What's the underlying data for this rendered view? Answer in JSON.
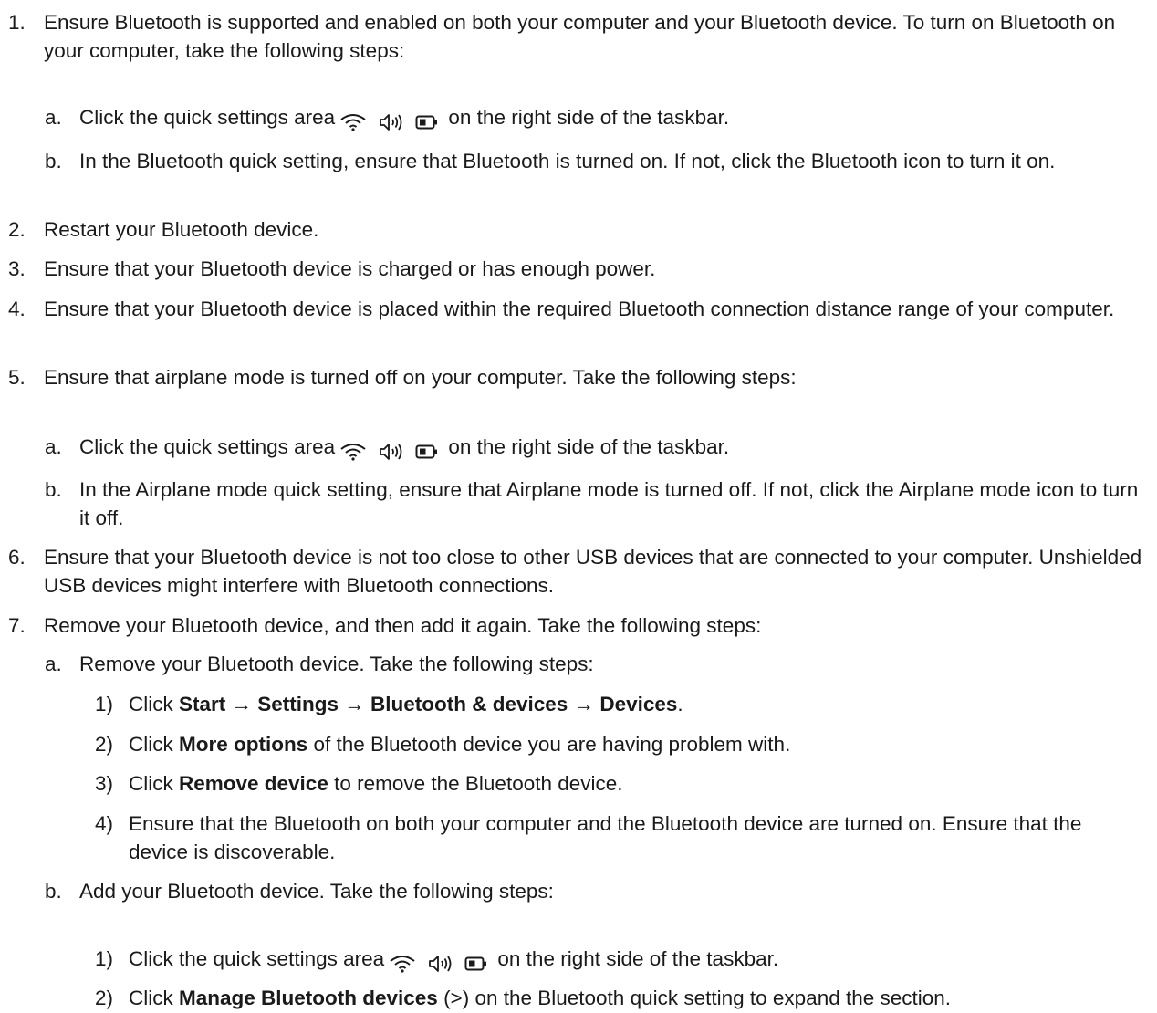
{
  "steps": [
    {
      "num": "1.",
      "text": "Ensure Bluetooth is supported and enabled on both your computer and your Bluetooth device. To turn on Bluetooth on your computer, take the following steps:"
    },
    {
      "num": "a.",
      "pre": "Click the quick settings area",
      "post": "on the right side of the taskbar."
    },
    {
      "num": "b.",
      "text": "In the Bluetooth quick setting, ensure that Bluetooth is turned on. If not, click the Bluetooth icon to turn it on."
    },
    {
      "num": "2.",
      "text": "Restart your Bluetooth device."
    },
    {
      "num": "3.",
      "text": "Ensure that your Bluetooth device is charged or has enough power."
    },
    {
      "num": "4.",
      "text": "Ensure that your Bluetooth device is placed within the required Bluetooth connection distance range of your computer."
    },
    {
      "num": "5.",
      "text": "Ensure that airplane mode is turned off on your computer. Take the following steps:"
    },
    {
      "num": "a.",
      "pre": "Click the quick settings area",
      "post": "on the right side of the taskbar."
    },
    {
      "num": "b.",
      "text": "In the Airplane mode quick setting, ensure that Airplane mode is turned off. If not, click the Airplane mode icon to turn it off."
    },
    {
      "num": "6.",
      "text": "Ensure that your Bluetooth device is not too close to other USB devices that are connected to your computer. Unshielded USB devices might interfere with Bluetooth connections."
    },
    {
      "num": "7.",
      "text": "Remove your Bluetooth device, and then add it again. Take the following steps:"
    },
    {
      "num": "a.",
      "text": "Remove your Bluetooth device. Take the following steps:"
    },
    {
      "num": "1)",
      "pre": "Click ",
      "bold": "Start → Settings → Bluetooth & devices → Devices",
      "post": "."
    },
    {
      "num": "2)",
      "pre": "Click ",
      "bold": "More options",
      "post": " of the Bluetooth device you are having problem with."
    },
    {
      "num": "3)",
      "pre": "Click ",
      "bold": "Remove device",
      "post": " to remove the Bluetooth device."
    },
    {
      "num": "4)",
      "text": "Ensure that the Bluetooth on both your computer and the Bluetooth device are turned on. Ensure that the device is discoverable."
    },
    {
      "num": "b.",
      "text": "Add your Bluetooth device. Take the following steps:"
    },
    {
      "num": "1)",
      "pre": "Click the quick settings area",
      "post": "on the right side of the taskbar."
    },
    {
      "num": "2)",
      "pre": "Click ",
      "bold": "Manage Bluetooth devices",
      "post": " (>) on the Bluetooth quick setting to expand the section."
    }
  ],
  "icons": [
    "wifi-icon",
    "volume-icon",
    "battery-icon"
  ]
}
